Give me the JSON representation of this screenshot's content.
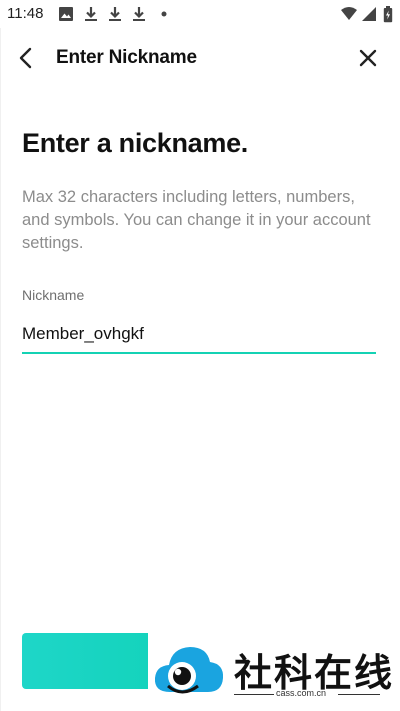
{
  "status_bar": {
    "time": "11:48",
    "left_icons": [
      "image-icon",
      "download-icon",
      "download-icon",
      "download-icon",
      "dot-icon"
    ],
    "right_icons": [
      "wifi-icon",
      "signal-icon",
      "battery-icon"
    ]
  },
  "header": {
    "title": "Enter Nickname",
    "back_icon": "chevron-left-icon",
    "close_icon": "close-icon"
  },
  "content": {
    "title": "Enter a nickname.",
    "description": "Max 32 characters including letters, numbers, and symbols. You can change it in your account settings.",
    "field_label": "Nickname",
    "field_value": "Member_ovhgkf"
  },
  "colors": {
    "accent": "#14d2b4",
    "description_text": "#8c8c8c"
  },
  "watermark": {
    "brand_text": "社科在线",
    "url": "cass.com.cn",
    "logo_icon": "cloud-eye-icon"
  }
}
